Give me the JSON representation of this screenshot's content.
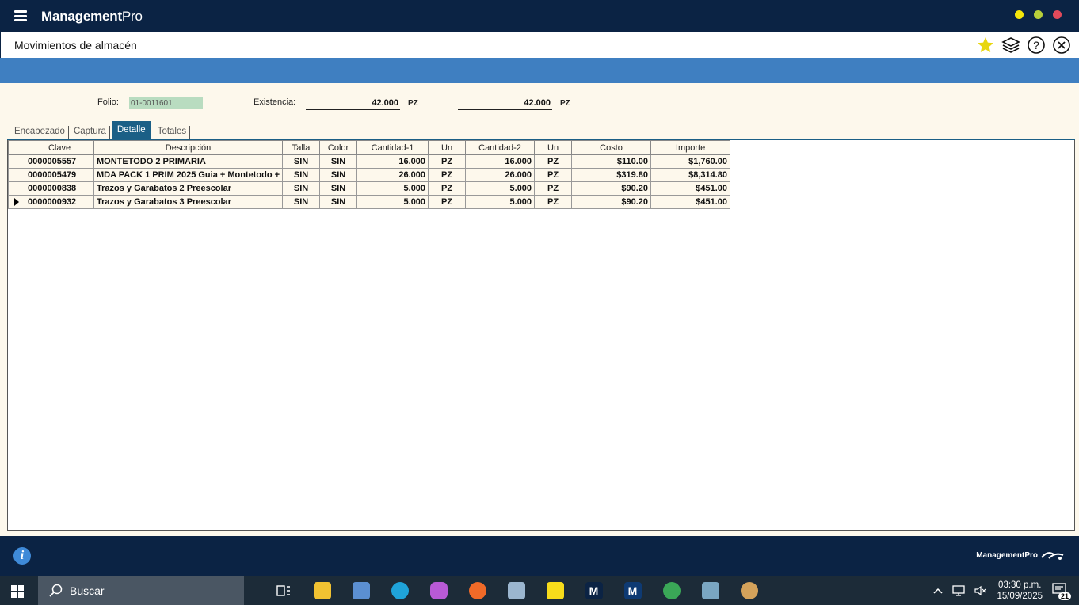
{
  "app": {
    "brand_main": "Management",
    "brand_pro": "Pro",
    "page_title": "Movimientos de almacén"
  },
  "header": {
    "folio_label": "Folio:",
    "folio_value": "01-0011601",
    "existencia_label": "Existencia:",
    "existencia_1": "42.000",
    "unit_1": "PZ",
    "existencia_2": "42.000",
    "unit_2": "PZ"
  },
  "tabs": [
    {
      "label": "Encabezado",
      "active": false
    },
    {
      "label": "Captura",
      "active": false
    },
    {
      "label": "Detalle",
      "active": true
    },
    {
      "label": "Totales",
      "active": false
    }
  ],
  "grid": {
    "columns": [
      "Clave",
      "Descripción",
      "Talla",
      "Color",
      "Cantidad-1",
      "Un",
      "Cantidad-2",
      "Un",
      "Costo",
      "Importe"
    ],
    "rows": [
      [
        "0000005557",
        "MONTETODO 2 PRIMARIA",
        "SIN",
        "SIN",
        "16.000",
        "PZ",
        "16.000",
        "PZ",
        "$110.00",
        "$1,760.00"
      ],
      [
        "0000005479",
        "MDA PACK 1 PRIM 2025 Guia + Montetodo +",
        "SIN",
        "SIN",
        "26.000",
        "PZ",
        "26.000",
        "PZ",
        "$319.80",
        "$8,314.80"
      ],
      [
        "0000000838",
        "Trazos y Garabatos 2 Preescolar",
        "SIN",
        "SIN",
        "5.000",
        "PZ",
        "5.000",
        "PZ",
        "$90.20",
        "$451.00"
      ],
      [
        "0000000932",
        "Trazos y Garabatos 3 Preescolar",
        "SIN",
        "SIN",
        "5.000",
        "PZ",
        "5.000",
        "PZ",
        "$90.20",
        "$451.00"
      ]
    ],
    "current_row": 3
  },
  "footer": {
    "brand": "ManagementPro"
  },
  "taskbar": {
    "search_label": "Buscar",
    "time": "03:30 p.m.",
    "date": "15/09/2025",
    "notifications": "21"
  },
  "colors": {
    "titlebar": "#0b2344",
    "accent_bar": "#3f7fc1",
    "active_tab": "#1b5f86",
    "panel_bg": "#fdf8ec",
    "folio_bg": "#b9dcc0"
  }
}
